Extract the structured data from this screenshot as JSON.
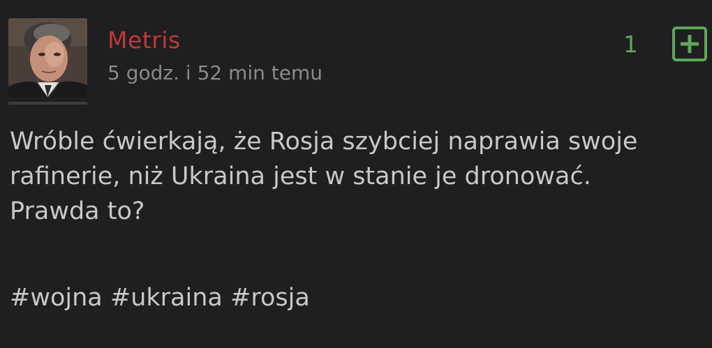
{
  "post": {
    "author": "Metris",
    "time": "5 godz. i 52 min temu",
    "votes": "1",
    "text_lines": [
      "Wróble ćwierkają, że Rosja szybciej naprawia swoje",
      "rafinerie, niż Ukraina jest w stanie je dronować.",
      "Prawda to?"
    ],
    "tags": [
      "#wojna",
      "#ukraina",
      "#rosja"
    ],
    "plus_icon": "plus-icon"
  },
  "colors": {
    "background": "#1f1f21",
    "author": "#c0393b",
    "timestamp": "#8a8a8c",
    "vote_accent": "#5ca85c",
    "body_text": "#c8c8ca"
  }
}
